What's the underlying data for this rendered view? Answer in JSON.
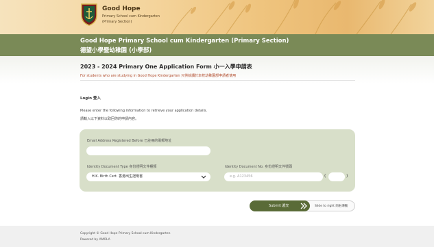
{
  "brand": {
    "name": "Good Hope",
    "subtitle_line1": "Primary School cum Kindergarten",
    "subtitle_line2": "(Primary Section)"
  },
  "titlebar": {
    "title_en": "Good Hope Primary School cum Kindergarten (Primary Section)",
    "title_zh": "德望小學暨幼稚園 (小學部)"
  },
  "form": {
    "title": "2023 - 2024 Primary One Application Form 小一入學申請表",
    "note": "For students who are studying in Good Hope Kindergarten 只供就讀於本校幼稚園部申請者使用",
    "login_label": "Login 登入",
    "instruction_en": "Please enter the following information to retrieve your application details.",
    "instruction_zh": "請輸入以下資料以取回你的申請內容。"
  },
  "fields": {
    "email_label": "Email Address Registered Before 已註冊的電郵地址",
    "email_value": "",
    "id_type_label": "Identity Document Type 身份證明文件種類",
    "id_type_value": "H.K. Birth Cert. 香港出生證明書",
    "id_no_label": "Identity Document No. 身份證明文件號碼",
    "id_no_placeholder": "e.g. A123456",
    "check_digit_value": "",
    "paren_left": "(",
    "paren_right": ")"
  },
  "slider": {
    "submit_label": "Submit 遞交",
    "hint": "Slide to right 向右滑動"
  },
  "footer": {
    "copyright": "Copyright © Good Hope Primary School cum Kindergarten",
    "powered_by": "Powered by AMOLA"
  },
  "colors": {
    "titlebar": "#7a8a57",
    "card": "#d8dfc9",
    "slider_thumb": "#5a6b37",
    "note_text": "#b04a2a"
  },
  "icons": {
    "crest": "school-crest-icon",
    "dropdown": "chevron-down-icon",
    "slider_arrow": "double-chevron-right-icon"
  }
}
